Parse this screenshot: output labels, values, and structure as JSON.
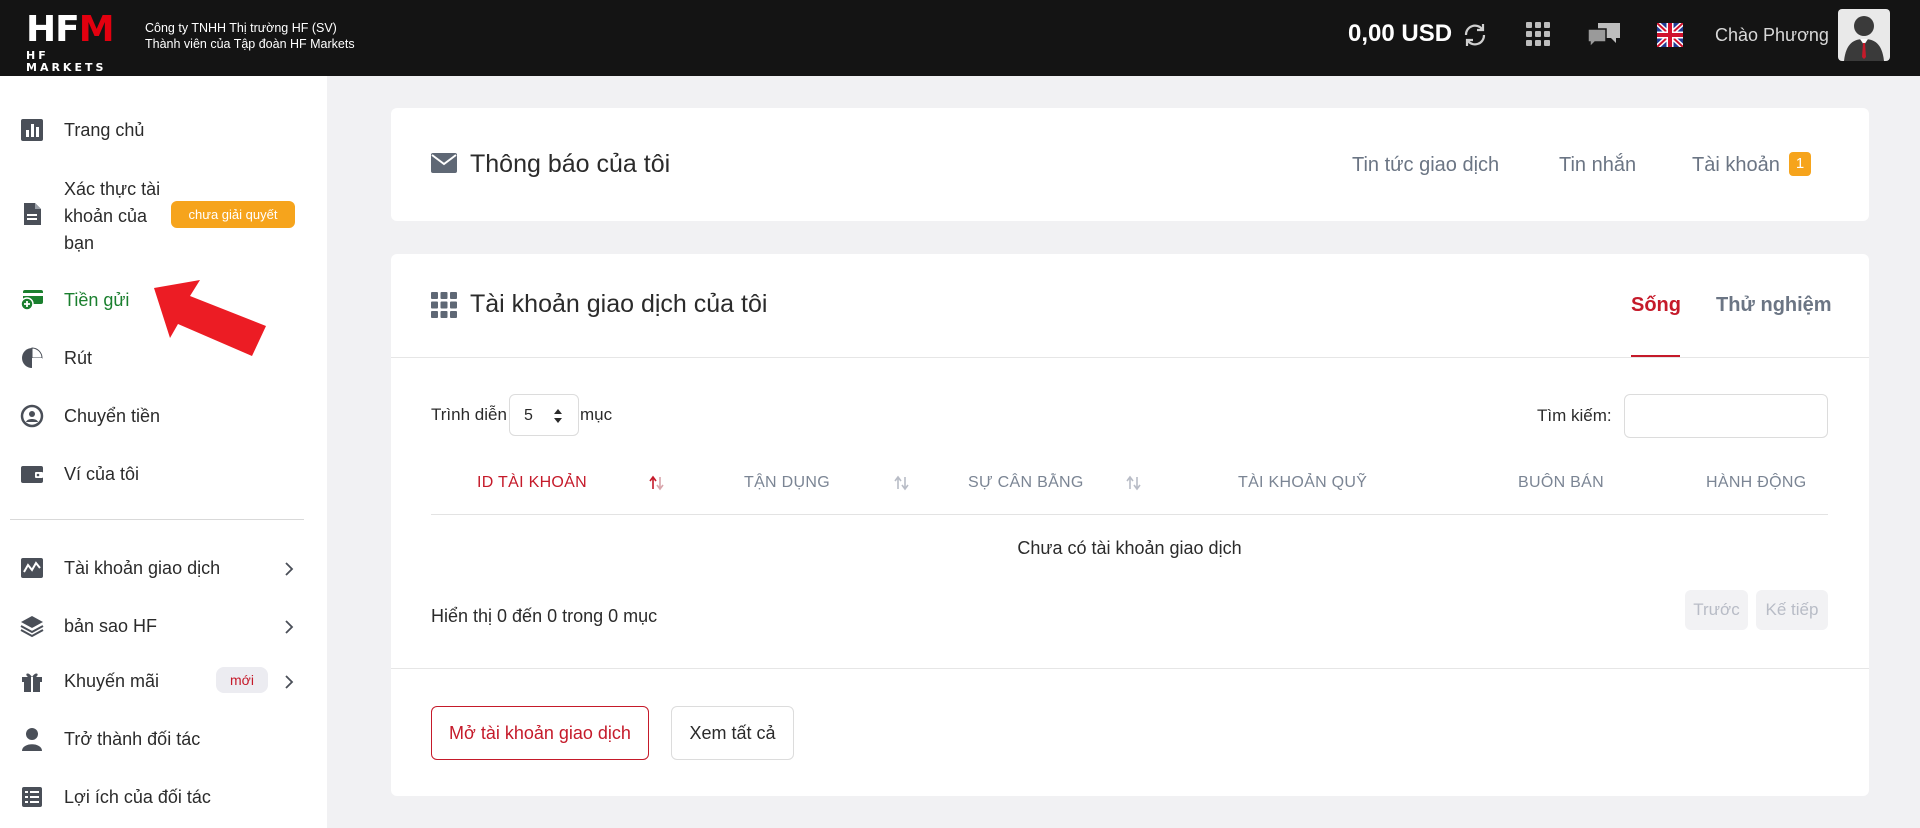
{
  "header": {
    "logo_text_main": "HFM",
    "logo_text_sub": "HF MARKETS",
    "company_line1": "Công ty TNHH Thị trường HF (SV)",
    "company_line2": "Thành viên của Tập đoàn HF Markets",
    "balance": "0,00 USD",
    "greeting": "Chào Phương",
    "icons": [
      "refresh-icon",
      "apps-grid-icon",
      "chat-icon",
      "uk-flag-icon",
      "avatar"
    ]
  },
  "sidebar": {
    "items": [
      {
        "label": "Trang chủ",
        "icon": "chart-bar-icon"
      },
      {
        "label": "Xác thực tài khoản của bạn",
        "line1": "Xác thực tài",
        "line2": "khoản của",
        "line3": "bạn",
        "icon": "document-icon",
        "badge": "chưa giải quyết"
      },
      {
        "label": "Tiền gửi",
        "icon": "deposit-icon",
        "active": true
      },
      {
        "label": "Rút",
        "icon": "withdraw-icon"
      },
      {
        "label": "Chuyển tiền",
        "icon": "transfer-icon"
      },
      {
        "label": "Ví của tôi",
        "icon": "wallet-icon"
      },
      {
        "label": "Tài khoản giao dịch",
        "icon": "trading-chart-icon",
        "chevron": true
      },
      {
        "label": "bản sao HF",
        "icon": "layers-icon",
        "chevron": true
      },
      {
        "label": "Khuyến mãi",
        "icon": "gift-icon",
        "badge": "mới",
        "chevron": true
      },
      {
        "label": "Trở thành đối tác",
        "icon": "user-icon"
      },
      {
        "label": "Lợi ích của đối tác",
        "icon": "list-icon"
      }
    ]
  },
  "notifications": {
    "title": "Thông báo của tôi",
    "tabs": [
      "Tin tức giao dịch",
      "Tin nhắn",
      "Tài khoản"
    ],
    "account_count": "1"
  },
  "accounts": {
    "title": "Tài khoản giao dịch của tôi",
    "tabs": {
      "live": "Sống",
      "demo": "Thử nghiệm"
    },
    "show_label": "Trình diễn",
    "page_size": "5",
    "entries_label": "mục",
    "search_label": "Tìm kiếm:",
    "search_value": "",
    "columns": [
      "ID TÀI KHOẢN",
      "TẬN DỤNG",
      "SỰ CÂN BẰNG",
      "TÀI KHOẢN QUỸ",
      "BUÔN BÁN",
      "HÀNH ĐỘNG"
    ],
    "empty_message": "Chưa có tài khoản giao dịch",
    "info": "Hiển thị 0 đến 0 trong 0 mục",
    "prev": "Trước",
    "next": "Kế tiếp",
    "open_button": "Mở tài khoản giao dịch",
    "view_all_button": "Xem tất cả"
  },
  "colors": {
    "brand_red": "#c51a2a",
    "active_green": "#1a7f2e",
    "badge_orange": "#f6a41c",
    "topbar": "#141414"
  }
}
